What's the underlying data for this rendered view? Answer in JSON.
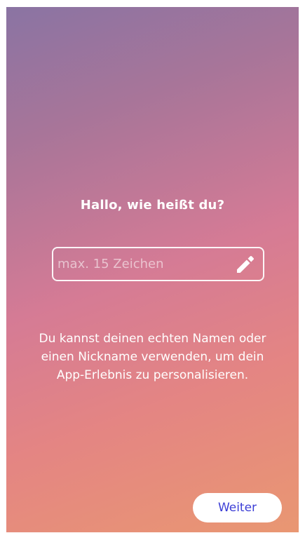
{
  "screen": {
    "title": "Hallo, wie heißt du?",
    "name_input": {
      "value": "",
      "placeholder": "max. 15 Zeichen",
      "edit_icon": "pencil-icon"
    },
    "description": "Du kannst deinen echten Namen oder einen Nickname verwenden, um dein App-Erlebnis zu personalisieren.",
    "next_button_label": "Weiter"
  },
  "colors": {
    "gradient_top": "#8a74a3",
    "gradient_middle": "#d57b95",
    "gradient_bottom": "#e99772",
    "button_text": "#3d3fd6",
    "text": "#ffffff"
  }
}
